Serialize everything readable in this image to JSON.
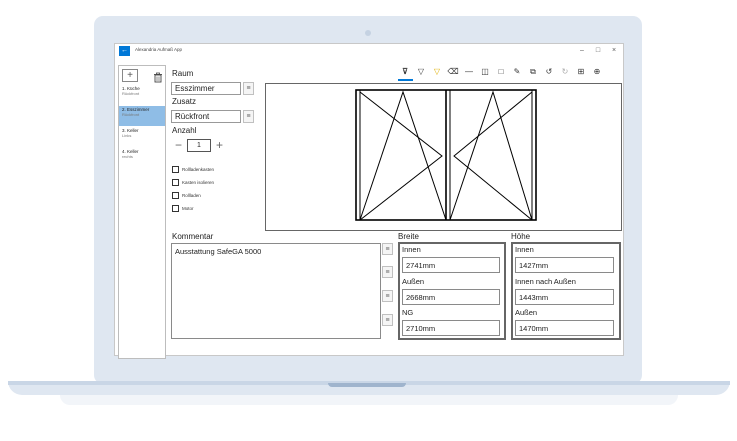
{
  "app": {
    "title": "Alexandria Aufmaß App"
  },
  "window_controls": {
    "minimize": "–",
    "maximize": "□",
    "close": "×"
  },
  "back_icon": "←",
  "sidebar": {
    "add_label": "+",
    "delete_icon": "trash-icon",
    "items": [
      {
        "title": "1. Küche",
        "sub": "Rückfront"
      },
      {
        "title": "2. Esszimmer",
        "sub": "Rückfront"
      },
      {
        "title": "3. Keller",
        "sub": "Links"
      },
      {
        "title": "4. Keller",
        "sub": "rechts"
      }
    ]
  },
  "form": {
    "raum_label": "Raum",
    "raum_value": "Esszimmer",
    "zusatz_label": "Zusatz",
    "zusatz_value": "Rückfront",
    "anzahl_label": "Anzahl",
    "anzahl_minus": "−",
    "anzahl_value": "1",
    "anzahl_plus": "+",
    "checkboxes": [
      "Rollladenkasten",
      "Kasten isolieren",
      "Rollladen",
      "Motor"
    ]
  },
  "toolbar": {
    "icons": [
      "filter-icon",
      "filter-icon",
      "filter-highlight-icon",
      "eraser-icon",
      "line-icon",
      "panel-icon",
      "square-icon",
      "pen-icon",
      "copy-icon",
      "undo-icon",
      "redo-icon",
      "grid-icon",
      "network-icon"
    ],
    "glyphs": [
      "⊽",
      "▽",
      "▽",
      "⌫",
      "—",
      "◫",
      "□",
      "✎",
      "⧉",
      "↺",
      "↻",
      "⊞",
      "⊕"
    ]
  },
  "list_icon_glyph": "≡",
  "kommentar": {
    "label": "Kommentar",
    "text": "Ausstattung SafeGA 5000"
  },
  "breite": {
    "label": "Breite",
    "fields": [
      {
        "label": "Innen",
        "value": "2741mm"
      },
      {
        "label": "Außen",
        "value": "2668mm"
      },
      {
        "label": "NG",
        "value": "2710mm"
      }
    ]
  },
  "hoehe": {
    "label": "Höhe",
    "fields": [
      {
        "label": "Innen",
        "value": "1427mm"
      },
      {
        "label": "Innen nach Außen",
        "value": "1443mm"
      },
      {
        "label": "Außen",
        "value": "1470mm"
      }
    ]
  },
  "colors": {
    "accent": "#0078d7",
    "selection": "#8fbde6",
    "toolbar_highlight": "#e0b000",
    "laptop": "#dfe7f1"
  }
}
